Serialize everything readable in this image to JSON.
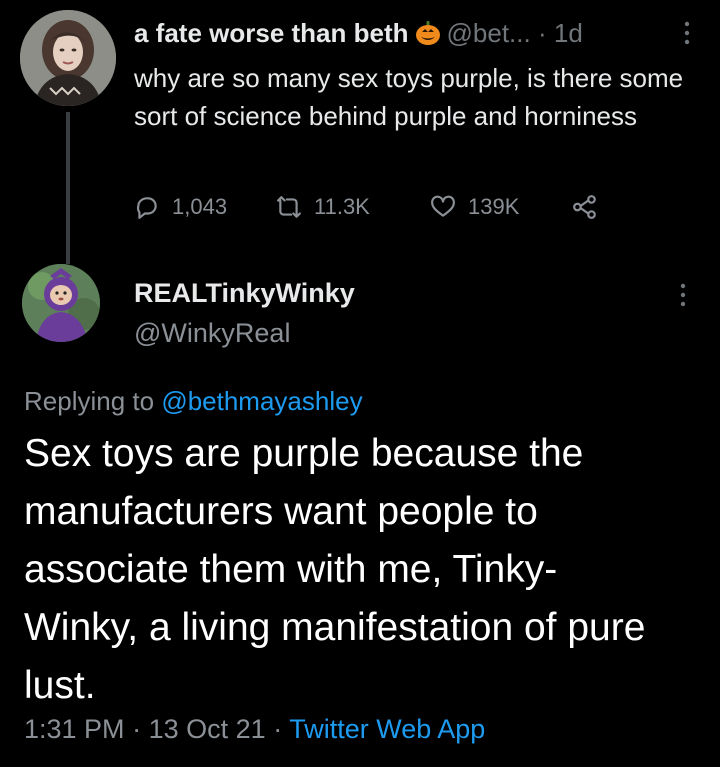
{
  "tweet1": {
    "display_name": "a fate worse than beth",
    "emoji": "jack-o-lantern",
    "handle": "@bet...",
    "separator": "·",
    "time": "1d",
    "text": "why are so many sex toys purple, is there some sort of science behind purple and horniness",
    "replies": "1,043",
    "retweets": "11.3K",
    "likes": "139K"
  },
  "tweet2": {
    "display_name": "REALTinkyWinky",
    "handle": "@WinkyReal",
    "replying_prefix": "Replying to",
    "replying_to": "@bethmayashley",
    "text": "Sex toys are purple because the manufacturers want people to associate them with me, Tinky-Winky, a living manifestation of pure lust.",
    "time": "1:31 PM",
    "sep1": "·",
    "date": "13 Oct 21",
    "sep2": "·",
    "source": "Twitter Web App"
  },
  "colors": {
    "background": "#000000",
    "text": "#e7e9ea",
    "muted": "#8b9096",
    "link": "#1d9bf0",
    "thread_line": "#3a3d41"
  },
  "icons": [
    "reply-icon",
    "retweet-icon",
    "like-icon",
    "share-icon",
    "more-icon",
    "pumpkin-emoji"
  ]
}
